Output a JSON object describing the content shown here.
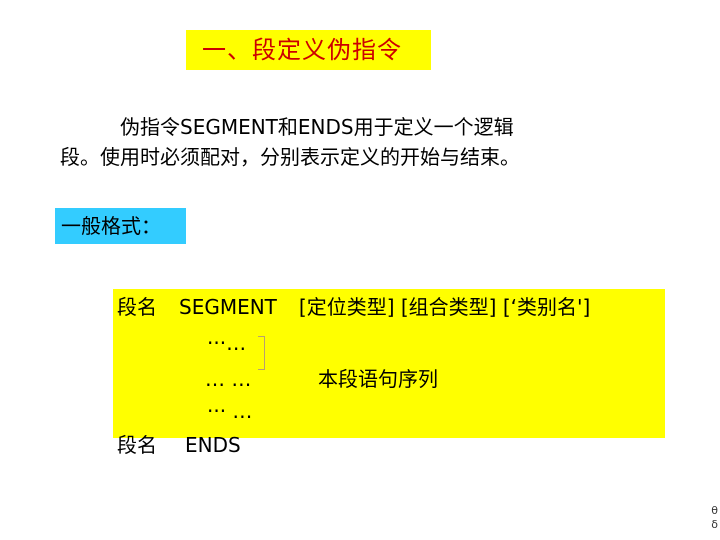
{
  "title": "一、段定义伪指令",
  "description": {
    "line1": "伪指令SEGMENT和ENDS用于定义一个逻辑",
    "line2": "段。使用时必须配对，分别表示定义的开始与结束。"
  },
  "format_label": "一般格式：",
  "code": {
    "line1_name": "段名",
    "line1_keyword": "SEGMENT",
    "line1_args": "[定位类型] [组合类型] [‘类别名']",
    "ellipsis1": "···…",
    "ellipsis2": "… …",
    "ellipsis3": "··· …",
    "annotation": "本段语句序列",
    "end_name": "段名",
    "end_keyword": "ENDS"
  },
  "corner_marks": [
    "θ",
    "δ"
  ],
  "colors": {
    "title_bg": "#ffff00",
    "title_text": "#cc0000",
    "format_bg": "#33ccff",
    "code_bg": "#ffff00"
  }
}
